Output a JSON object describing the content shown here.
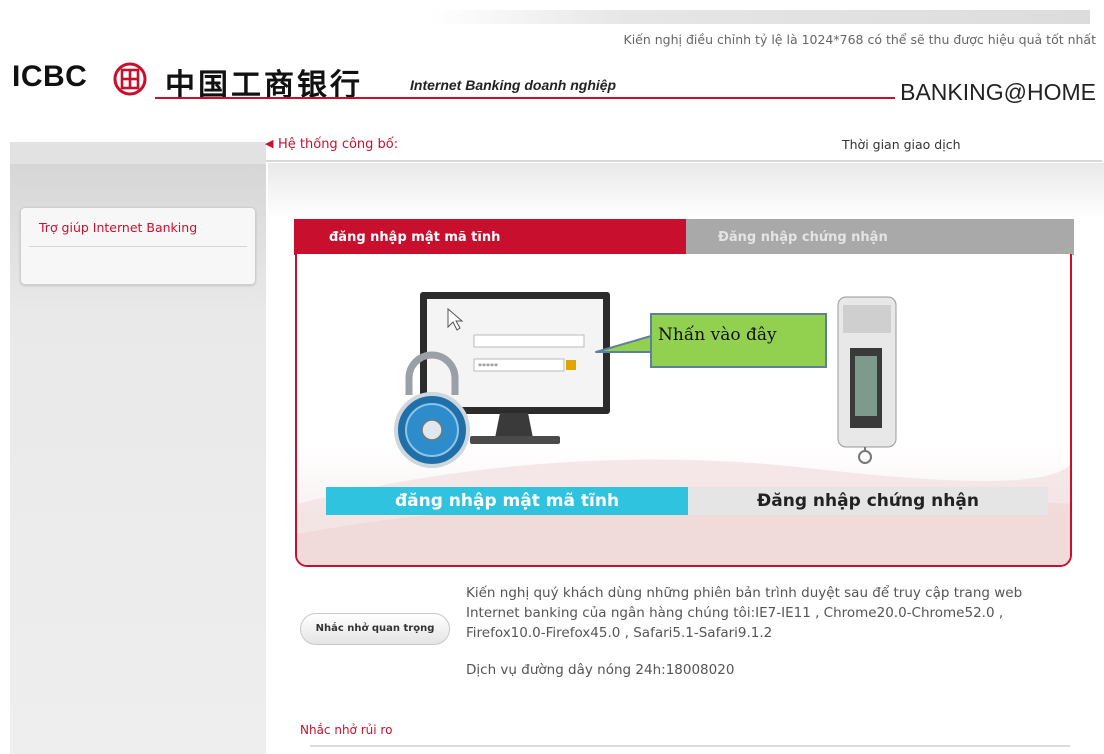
{
  "header": {
    "resolution_hint": "Kiến nghị điều chỉnh tỷ lệ là 1024*768 có thể sẽ thu được hiệu quả tốt nhất",
    "logo_text": "ICBC",
    "logo_chinese": "中国工商银行",
    "product_name": "Internet Banking doanh nghiệp",
    "brand_tagline": "BANKING@HOME",
    "brand_color": "#c8102e"
  },
  "announcement": {
    "label": "Hệ thống công bố:",
    "time_label": "Thời gian giao dịch"
  },
  "sidebar": {
    "help_link": "Trợ giúp Internet Banking"
  },
  "login": {
    "tabs": [
      {
        "label": "đăng nhập mật mã tĩnh",
        "active": true
      },
      {
        "label": "Đăng nhập chứng nhận",
        "active": false
      }
    ],
    "callout": "Nhấn vào đây",
    "buttons": {
      "static_password": "đăng nhập mật mã tĩnh",
      "certificate": "Đăng nhập chứng nhận"
    },
    "colors": {
      "active_tab": "#c8102e",
      "inactive_tab": "#a9a9a9",
      "static_button": "#2fc3e0",
      "callout_fill": "#92d050"
    },
    "icons": [
      "monitor-icon",
      "padlock-icon",
      "usb-token-icon"
    ]
  },
  "reminder": {
    "badge": "Nhắc nhở quan trọng",
    "browser_note": "Kiến nghị quý khách dùng những phiên bản trình duyệt sau để truy cập trang web Internet banking của ngân hàng chúng tôi:IE7-IE11 , Chrome20.0-Chrome52.0 , Firefox10.0-Firefox45.0 , Safari5.1-Safari9.1.2",
    "hotline": "Dịch vụ đường dây nóng 24h:18008020",
    "risk_title": "Nhắc nhở rủi ro"
  }
}
